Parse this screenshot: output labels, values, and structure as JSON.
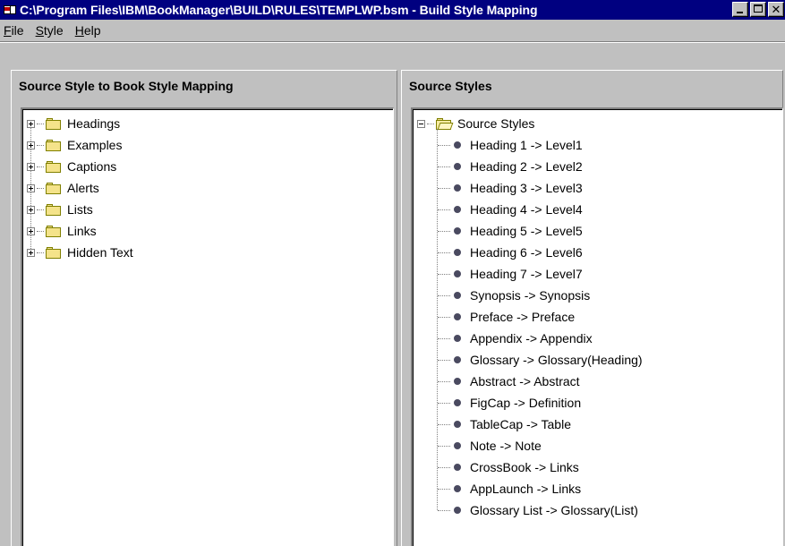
{
  "window": {
    "title": "C:\\Program Files\\IBM\\BookManager\\BUILD\\RULES\\TEMPLWP.bsm - Build Style Mapping",
    "title_icon": "bookmanager-app-icon",
    "controls": [
      "minimize",
      "maximize",
      "close"
    ]
  },
  "menu": {
    "items": [
      {
        "label": "File",
        "mnemonic": "F",
        "rest": "ile"
      },
      {
        "label": "Style",
        "mnemonic": "S",
        "rest": "tyle"
      },
      {
        "label": "Help",
        "mnemonic": "H",
        "rest": "elp"
      }
    ]
  },
  "left_panel": {
    "heading": "Source Style to Book Style Mapping",
    "items": [
      {
        "label": "Headings",
        "state": "collapsed",
        "icon": "folder-icon"
      },
      {
        "label": "Examples",
        "state": "collapsed",
        "icon": "folder-icon"
      },
      {
        "label": "Captions",
        "state": "collapsed",
        "icon": "folder-icon"
      },
      {
        "label": "Alerts",
        "state": "collapsed",
        "icon": "folder-icon"
      },
      {
        "label": "Lists",
        "state": "collapsed",
        "icon": "folder-icon"
      },
      {
        "label": "Links",
        "state": "collapsed",
        "icon": "folder-icon"
      },
      {
        "label": "Hidden Text",
        "state": "collapsed",
        "icon": "folder-icon"
      }
    ]
  },
  "right_panel": {
    "heading": "Source Styles",
    "root": {
      "label": "Source Styles",
      "state": "expanded",
      "icon": "open-folder-icon"
    },
    "items": [
      "Heading 1 -> Level1",
      "Heading 2 -> Level2",
      "Heading 3 -> Level3",
      "Heading 4 -> Level4",
      "Heading 5 -> Level5",
      "Heading 6 -> Level6",
      "Heading 7 -> Level7",
      "Synopsis -> Synopsis",
      "Preface -> Preface",
      "Appendix -> Appendix",
      "Glossary -> Glossary(Heading)",
      "Abstract -> Abstract",
      "FigCap -> Definition",
      "TableCap -> Table",
      "Note -> Note",
      "CrossBook -> Links",
      "AppLaunch -> Links",
      "Glossary List -> Glossary(List)"
    ]
  },
  "colors": {
    "titlebar": "#000080",
    "face": "#c0c0c0",
    "tree_bg": "#ffffff",
    "folder": "#f4e38a",
    "bullet": "#4a4a60"
  }
}
